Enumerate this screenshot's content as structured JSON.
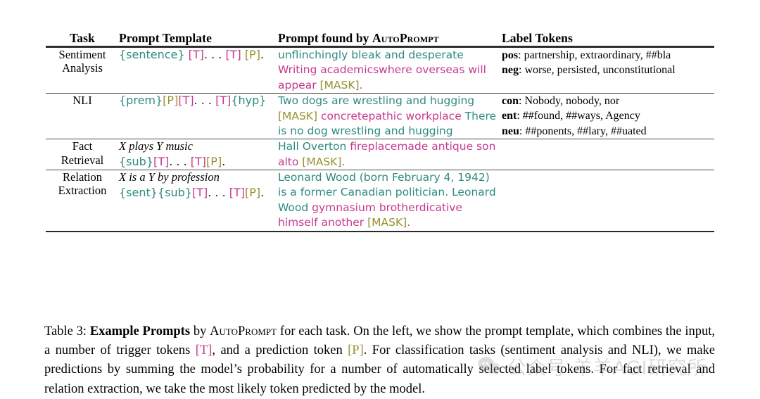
{
  "colors": {
    "context": "#2e8b80",
    "trigger": "#c7398f",
    "prediction": "#97922b",
    "rule": "#2a2a2a",
    "watermark": "#8d8d8d"
  },
  "table": {
    "headers": {
      "task": "Task",
      "template": "Prompt Template",
      "found_prefix": "Prompt found by ",
      "found_method": "AutoPrompt",
      "label": "Label Tokens"
    },
    "rows": [
      {
        "task": "Sentiment\nAnalysis",
        "template_italic": "",
        "template_tokens": [
          {
            "t": "{sentence}",
            "c": "ctx"
          },
          {
            "t": " ",
            "c": "plain"
          },
          {
            "t": "[T]",
            "c": "trig"
          },
          {
            "t": ". . . ",
            "c": "plain"
          },
          {
            "t": "[T]",
            "c": "trig"
          },
          {
            "t": " ",
            "c": "plain"
          },
          {
            "t": "[P]",
            "c": "pred"
          },
          {
            "t": ".",
            "c": "plain"
          }
        ],
        "found_tokens": [
          {
            "t": "unflinchingly bleak and desperate ",
            "c": "ctx"
          },
          {
            "t": "Writing academicswhere overseas will appear ",
            "c": "trig"
          },
          {
            "t": "[MASK]",
            "c": "pred"
          },
          {
            "t": ".",
            "c": "trig"
          }
        ],
        "labels": [
          {
            "key": "pos",
            "value": ": partnership, extraordinary, ##bla"
          },
          {
            "key": "neg",
            "value": ": worse, persisted, unconstitutional"
          }
        ]
      },
      {
        "task": "NLI",
        "template_italic": "",
        "template_tokens": [
          {
            "t": "{prem}",
            "c": "ctx"
          },
          {
            "t": "[P]",
            "c": "pred"
          },
          {
            "t": "[T]",
            "c": "trig"
          },
          {
            "t": ". . . ",
            "c": "plain"
          },
          {
            "t": "[T]",
            "c": "trig"
          },
          {
            "t": "{hyp}",
            "c": "ctx"
          }
        ],
        "found_tokens": [
          {
            "t": "Two dogs are wrestling and hugging ",
            "c": "ctx"
          },
          {
            "t": "[MASK]",
            "c": "pred"
          },
          {
            "t": " concretepathic workplace ",
            "c": "trig"
          },
          {
            "t": "There is no dog wrestling and hugging",
            "c": "ctx"
          }
        ],
        "labels": [
          {
            "key": "con",
            "value": ": Nobody, nobody, nor"
          },
          {
            "key": "ent",
            "value": ": ##found, ##ways, Agency"
          },
          {
            "key": "neu",
            "value": ": ##ponents, ##lary, ##uated"
          }
        ]
      },
      {
        "task": "Fact\nRetrieval",
        "template_italic": "X plays Y music",
        "template_tokens": [
          {
            "t": "{sub}",
            "c": "ctx"
          },
          {
            "t": "[T]",
            "c": "trig"
          },
          {
            "t": ". . . ",
            "c": "plain"
          },
          {
            "t": "[T]",
            "c": "trig"
          },
          {
            "t": "[P]",
            "c": "pred"
          },
          {
            "t": ".",
            "c": "plain"
          }
        ],
        "found_tokens": [
          {
            "t": "Hall Overton ",
            "c": "ctx"
          },
          {
            "t": "fireplacemade antique son alto ",
            "c": "trig"
          },
          {
            "t": "[MASK]",
            "c": "pred"
          },
          {
            "t": ".",
            "c": "trig"
          }
        ],
        "labels": []
      },
      {
        "task": "Relation\nExtraction",
        "template_italic": "X is a Y by profession",
        "template_tokens": [
          {
            "t": "{sent}",
            "c": "ctx"
          },
          {
            "t": "{sub}",
            "c": "ctx"
          },
          {
            "t": "[T]",
            "c": "trig"
          },
          {
            "t": ". . . ",
            "c": "plain"
          },
          {
            "t": "[T]",
            "c": "trig"
          },
          {
            "t": "[P]",
            "c": "pred"
          },
          {
            "t": ".",
            "c": "plain"
          }
        ],
        "found_tokens": [
          {
            "t": "Leonard Wood (born February 4, 1942) is a former Canadian politician. Leonard Wood ",
            "c": "ctx"
          },
          {
            "t": "gymnasium brotherdicative himself another ",
            "c": "trig"
          },
          {
            "t": "[MASK]",
            "c": "pred"
          },
          {
            "t": ".",
            "c": "trig"
          }
        ],
        "labels": []
      }
    ]
  },
  "caption": {
    "number": "Table 3: ",
    "bold_title": "Example Prompts",
    "seg1": " by ",
    "method": "AutoPrompt",
    "seg2": " for each task.  On the left, we show the prompt template, which combines the input, a number of trigger tokens ",
    "trigger_token": "[T]",
    "seg3": ", and a prediction token ",
    "prediction_token": "[P]",
    "seg4": ". For classification tasks (sentiment analysis and NLI), we make predictions by summing the model’s probability for a number of automatically selected label tokens. For fact retrieval and relation extraction, we take the most likely token predicted by the model."
  },
  "watermark": {
    "text": "公众号 羊羊AGI研究所",
    "logo": "chat-bubble-icon"
  }
}
